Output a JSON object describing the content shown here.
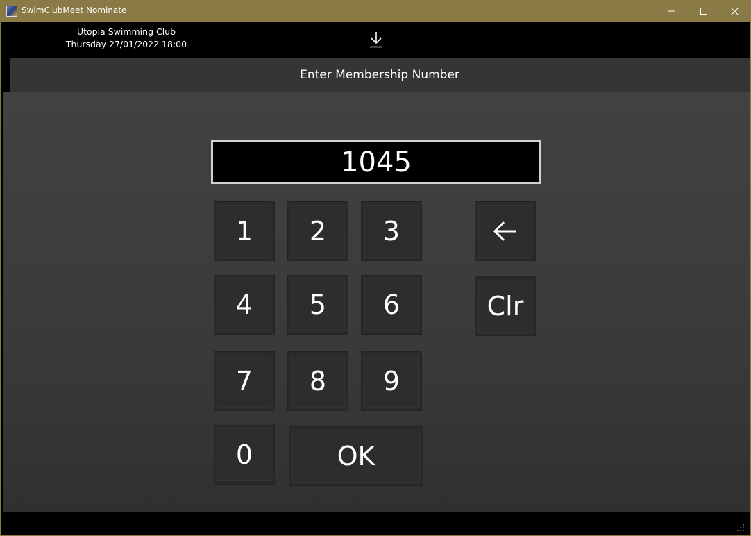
{
  "window": {
    "title": "SwimClubMeet Nominate",
    "titlebar_color": "#8a7a45"
  },
  "header": {
    "club_name": "Utopia Swimming Club",
    "meet_date": "Thursday 27/01/2022 18:00",
    "download_icon": "download-icon"
  },
  "heading": {
    "text": "Enter Membership Number"
  },
  "display": {
    "value": "1045"
  },
  "keypad": {
    "k1": "1",
    "k2": "2",
    "k3": "3",
    "k4": "4",
    "k5": "5",
    "k6": "6",
    "k7": "7",
    "k8": "8",
    "k9": "9",
    "k0": "0",
    "ok": "OK",
    "clear": "Clr",
    "backspace_icon": "backspace-arrow-icon"
  }
}
